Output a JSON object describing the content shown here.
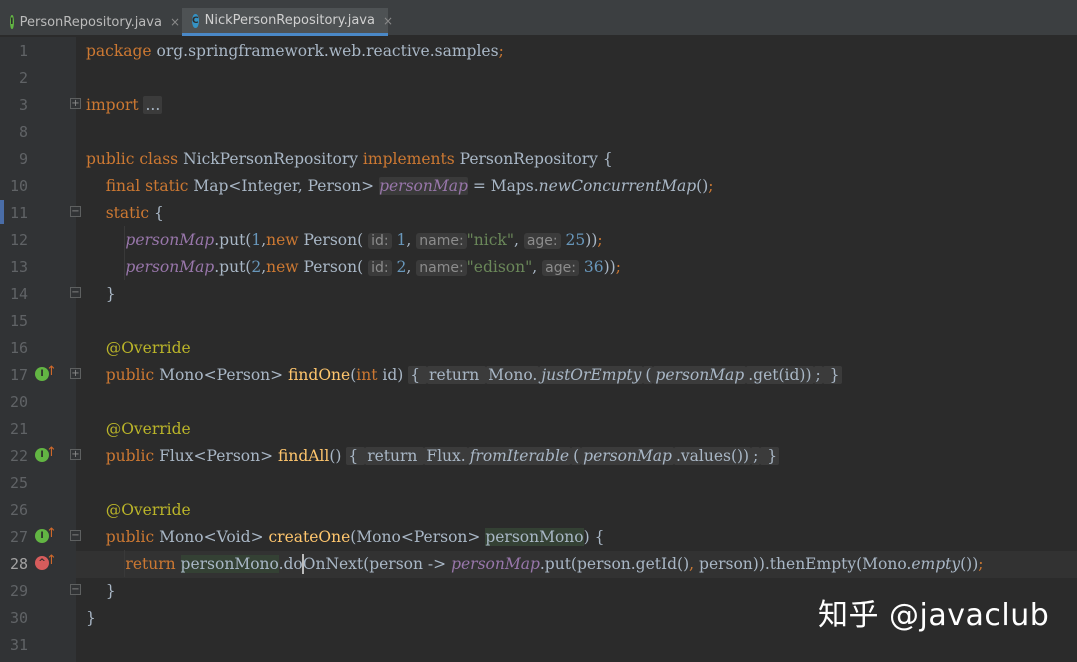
{
  "tabs": [
    {
      "label": "PersonRepository.java",
      "icon": "interface-icon",
      "icon_letter": "I",
      "active": false
    },
    {
      "label": "NickPersonRepository.java",
      "icon": "class-icon",
      "icon_letter": "C",
      "active": true
    }
  ],
  "tab_close_glyph": "×",
  "gutter_icons": {
    "implements_letter": "I",
    "overrides_letter": "^",
    "arrow": "↑"
  },
  "fold_glyphs": {
    "expand": "+",
    "collapse": "−"
  },
  "lines": [
    {
      "n": "1",
      "segments": [
        {
          "t": "package ",
          "c": "kw"
        },
        {
          "t": "org.springframework.web.reactive.samples"
        },
        {
          "t": ";",
          "c": "kw"
        }
      ]
    },
    {
      "n": "2",
      "segments": []
    },
    {
      "n": "3",
      "segments": [
        {
          "t": "import ",
          "c": "kw"
        },
        {
          "t": "...",
          "c": "fold"
        }
      ]
    },
    {
      "n": "8",
      "segments": []
    },
    {
      "n": "9",
      "segments": [
        {
          "t": "public class ",
          "c": "kw"
        },
        {
          "t": "NickPersonRepository "
        },
        {
          "t": "implements ",
          "c": "kw"
        },
        {
          "t": "PersonRepository {"
        }
      ]
    },
    {
      "n": "10",
      "segments": [
        {
          "t": "    "
        },
        {
          "t": "final static ",
          "c": "kw"
        },
        {
          "t": "Map<Integer, Person> "
        },
        {
          "t": "personMap",
          "c": "fld fieldbox"
        },
        {
          "t": " = Maps."
        },
        {
          "t": "newConcurrentMap",
          "c": "it"
        },
        {
          "t": "()"
        },
        {
          "t": ";",
          "c": "kw"
        }
      ]
    },
    {
      "n": "11",
      "segments": [
        {
          "t": "    "
        },
        {
          "t": "static ",
          "c": "kw"
        },
        {
          "t": "{"
        }
      ]
    },
    {
      "n": "12",
      "segments": [
        {
          "t": "        "
        },
        {
          "t": "personMap",
          "c": "fld"
        },
        {
          "t": ".put("
        },
        {
          "t": "1",
          "c": "num"
        },
        {
          "t": ","
        },
        {
          "t": "new ",
          "c": "kw"
        },
        {
          "t": "Person( "
        },
        {
          "t": "id:",
          "c": "hint"
        },
        {
          "t": " "
        },
        {
          "t": "1",
          "c": "num"
        },
        {
          "t": ", "
        },
        {
          "t": "name:",
          "c": "hint"
        },
        {
          "t": "\"nick\"",
          "c": "st"
        },
        {
          "t": ", "
        },
        {
          "t": "age:",
          "c": "hint"
        },
        {
          "t": " "
        },
        {
          "t": "25",
          "c": "num"
        },
        {
          "t": "))"
        },
        {
          "t": ";",
          "c": "kw"
        }
      ]
    },
    {
      "n": "13",
      "segments": [
        {
          "t": "        "
        },
        {
          "t": "personMap",
          "c": "fld"
        },
        {
          "t": ".put("
        },
        {
          "t": "2",
          "c": "num"
        },
        {
          "t": ","
        },
        {
          "t": "new ",
          "c": "kw"
        },
        {
          "t": "Person( "
        },
        {
          "t": "id:",
          "c": "hint"
        },
        {
          "t": " "
        },
        {
          "t": "2",
          "c": "num"
        },
        {
          "t": ", "
        },
        {
          "t": "name:",
          "c": "hint"
        },
        {
          "t": "\"edison\"",
          "c": "st"
        },
        {
          "t": ", "
        },
        {
          "t": "age:",
          "c": "hint"
        },
        {
          "t": " "
        },
        {
          "t": "36",
          "c": "num"
        },
        {
          "t": "))"
        },
        {
          "t": ";",
          "c": "kw"
        }
      ]
    },
    {
      "n": "14",
      "segments": [
        {
          "t": "    }"
        }
      ]
    },
    {
      "n": "15",
      "segments": []
    },
    {
      "n": "16",
      "segments": [
        {
          "t": "    "
        },
        {
          "t": "@Override",
          "c": "an"
        }
      ]
    },
    {
      "n": "17",
      "segments": [
        {
          "t": "    "
        },
        {
          "t": "public ",
          "c": "kw"
        },
        {
          "t": "Mono<Person> "
        },
        {
          "t": "findOne",
          "c": "fn"
        },
        {
          "t": "("
        },
        {
          "t": "int ",
          "c": "kw"
        },
        {
          "t": "id) "
        },
        {
          "t": "{ ",
          "c": "fold"
        },
        {
          "t": "return ",
          "c": "kw fold"
        },
        {
          "t": "Mono.",
          "c": "fold"
        },
        {
          "t": "justOrEmpty",
          "c": "it fold"
        },
        {
          "t": "(",
          "c": "fold"
        },
        {
          "t": "personMap",
          "c": "fld fold"
        },
        {
          "t": ".get(id))",
          "c": "fold"
        },
        {
          "t": ";",
          "c": "kw fold"
        },
        {
          "t": " }",
          "c": "fold"
        }
      ]
    },
    {
      "n": "20",
      "segments": []
    },
    {
      "n": "21",
      "segments": [
        {
          "t": "    "
        },
        {
          "t": "@Override",
          "c": "an"
        }
      ]
    },
    {
      "n": "22",
      "segments": [
        {
          "t": "    "
        },
        {
          "t": "public ",
          "c": "kw"
        },
        {
          "t": "Flux<Person> "
        },
        {
          "t": "findAll",
          "c": "fn"
        },
        {
          "t": "() "
        },
        {
          "t": "{ ",
          "c": "fold"
        },
        {
          "t": "return ",
          "c": "kw fold"
        },
        {
          "t": "Flux.",
          "c": "fold"
        },
        {
          "t": "fromIterable",
          "c": "it fold"
        },
        {
          "t": "(",
          "c": "fold"
        },
        {
          "t": "personMap",
          "c": "fld fold"
        },
        {
          "t": ".values())",
          "c": "fold"
        },
        {
          "t": ";",
          "c": "kw fold"
        },
        {
          "t": " }",
          "c": "fold"
        }
      ]
    },
    {
      "n": "25",
      "segments": []
    },
    {
      "n": "26",
      "segments": [
        {
          "t": "    "
        },
        {
          "t": "@Override",
          "c": "an"
        }
      ]
    },
    {
      "n": "27",
      "segments": [
        {
          "t": "    "
        },
        {
          "t": "public ",
          "c": "kw"
        },
        {
          "t": "Mono<Void> "
        },
        {
          "t": "createOne",
          "c": "fn"
        },
        {
          "t": "(Mono<Person> "
        },
        {
          "t": "personMono",
          "c": "varhl"
        },
        {
          "t": ") {"
        }
      ]
    },
    {
      "n": "28",
      "segments": [
        {
          "t": "        "
        },
        {
          "t": "return ",
          "c": "kw"
        },
        {
          "t": "personMono",
          "c": "varhl"
        },
        {
          "t": ".doOnNext(person -> "
        },
        {
          "t": "personMap",
          "c": "fld"
        },
        {
          "t": ".put(person.getId()"
        },
        {
          "t": ", ",
          "c": "kw"
        },
        {
          "t": "person)).thenEmpty(Mono."
        },
        {
          "t": "empty",
          "c": "it"
        },
        {
          "t": "())"
        },
        {
          "t": ";",
          "c": "kw"
        }
      ]
    },
    {
      "n": "29",
      "segments": [
        {
          "t": "    }"
        }
      ]
    },
    {
      "n": "30",
      "segments": [
        {
          "t": "}"
        }
      ]
    },
    {
      "n": "31",
      "segments": []
    }
  ],
  "watermark": "知乎 @javaclub"
}
